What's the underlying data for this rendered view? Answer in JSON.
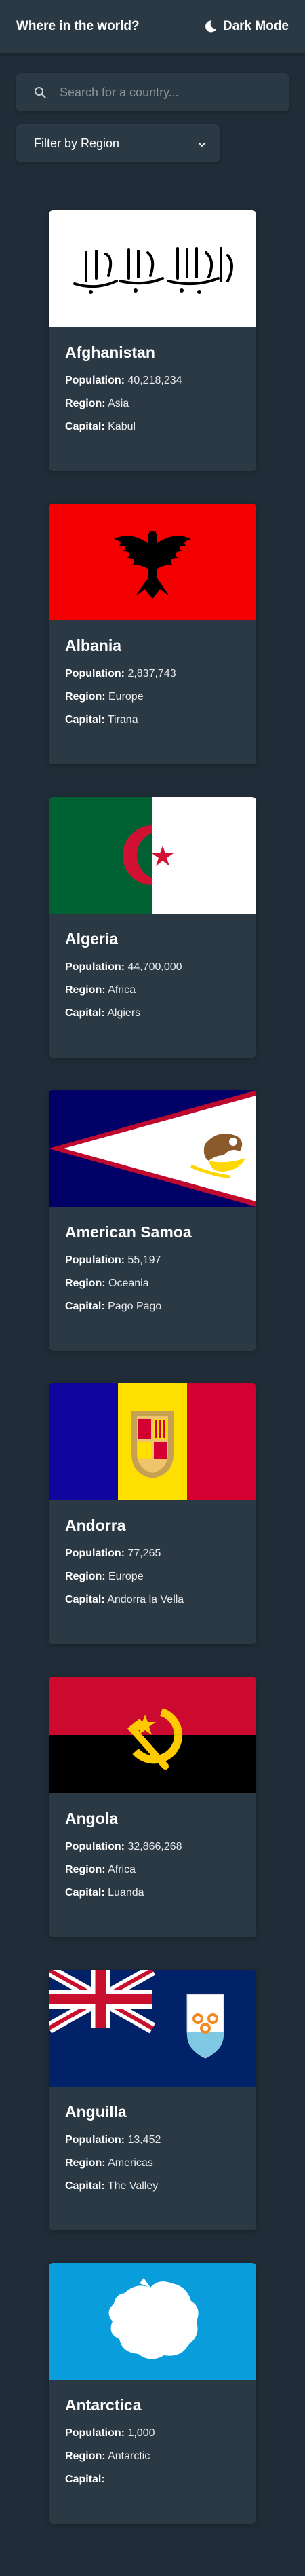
{
  "header": {
    "title": "Where in the world?",
    "dark_mode_label": "Dark Mode"
  },
  "search": {
    "placeholder": "Search for a country...",
    "value": ""
  },
  "filter": {
    "selected_label": "Filter by Region"
  },
  "labels": {
    "population": "Population:",
    "region": "Region:",
    "capital": "Capital:"
  },
  "countries": [
    {
      "name": "Afghanistan",
      "population": "40,218,234",
      "region": "Asia",
      "capital": "Kabul"
    },
    {
      "name": "Albania",
      "population": "2,837,743",
      "region": "Europe",
      "capital": "Tirana"
    },
    {
      "name": "Algeria",
      "population": "44,700,000",
      "region": "Africa",
      "capital": "Algiers"
    },
    {
      "name": "American Samoa",
      "population": "55,197",
      "region": "Oceania",
      "capital": "Pago Pago"
    },
    {
      "name": "Andorra",
      "population": "77,265",
      "region": "Europe",
      "capital": "Andorra la Vella"
    },
    {
      "name": "Angola",
      "population": "32,866,268",
      "region": "Africa",
      "capital": "Luanda"
    },
    {
      "name": "Anguilla",
      "population": "13,452",
      "region": "Americas",
      "capital": "The Valley"
    },
    {
      "name": "Antarctica",
      "population": "1,000",
      "region": "Antarctic",
      "capital": ""
    }
  ],
  "icons": {
    "moon": "moon-icon",
    "search": "search-icon",
    "dropdown": "chevron-down-icon"
  },
  "colors": {
    "background": "#202c37",
    "element": "#2b3945",
    "text": "#ffffff"
  }
}
